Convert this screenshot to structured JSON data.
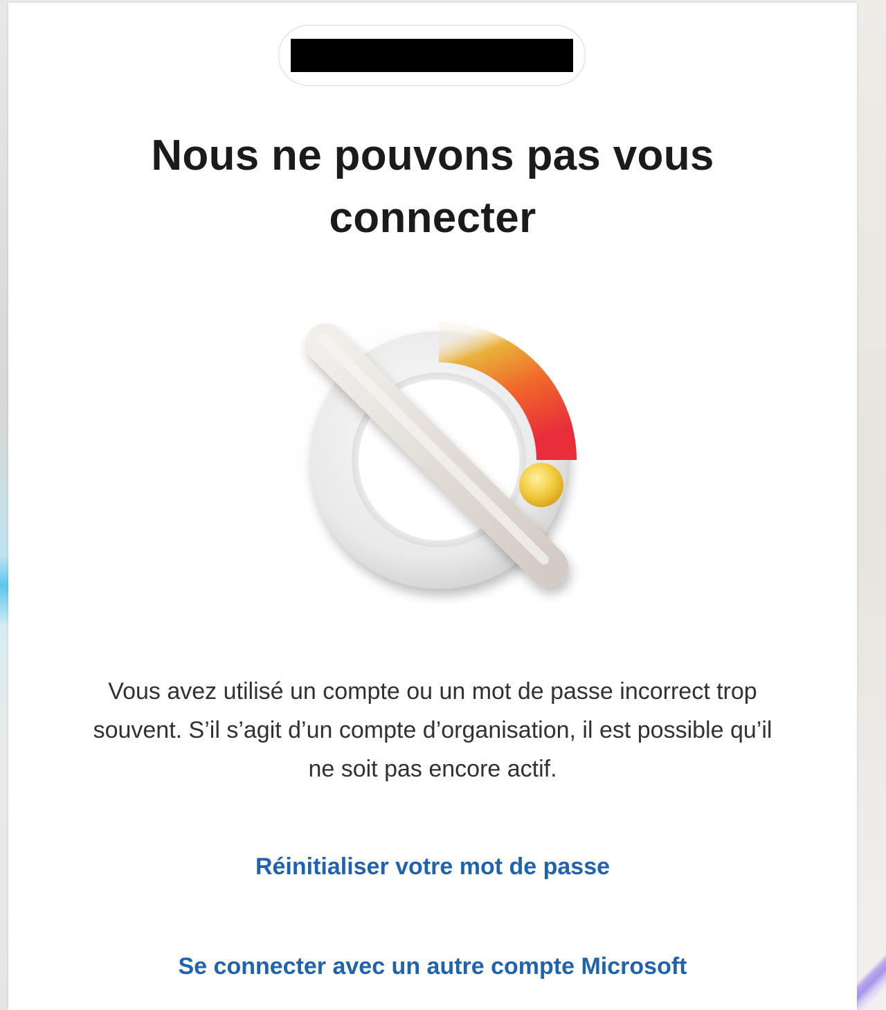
{
  "account_pill": {
    "redacted": true
  },
  "page": {
    "title_line1": "Nous ne pouvons pas vous",
    "title_line2": "connecter",
    "illustration_icon": "blocked-gauge-icon",
    "message": "Vous avez utilisé un compte ou un mot de passe incorrect trop souvent. S’il s’agit d’un compte d’organisation, il est possible qu’il ne soit pas encore actif."
  },
  "links": {
    "reset_password": "Réinitialiser votre mot de passe",
    "other_account": "Se connecter avec un autre compte Microsoft"
  },
  "colors": {
    "link": "#1f63b0",
    "title": "#1b1b1b",
    "body_text": "#323130",
    "background": "#ffffff"
  }
}
